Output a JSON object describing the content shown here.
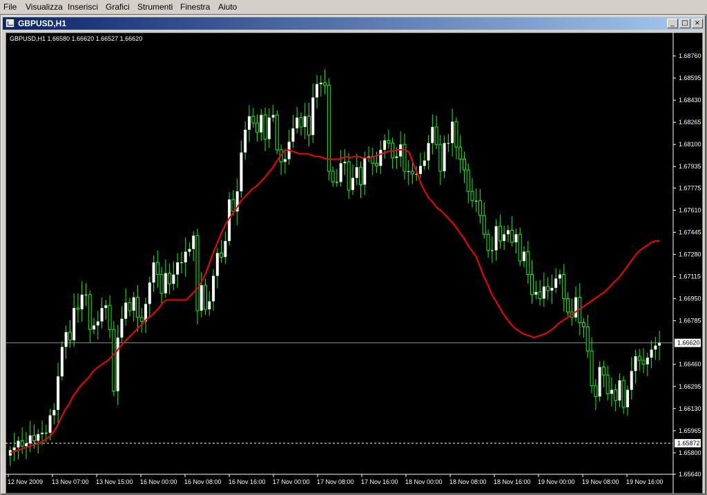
{
  "menu": [
    "File",
    "Visualizza",
    "Inserisci",
    "Grafici",
    "Strumenti",
    "Finestra",
    "Aiuto"
  ],
  "window": {
    "title": "GBPUSD,H1"
  },
  "chart_header": {
    "text": "GBPUSD,H1  1.66580 1.66620 1.66527 1.66620"
  },
  "colors": {
    "background": "#000000",
    "up_body": "#ffffff",
    "down_body": "#000000",
    "wick": "#00ff00",
    "ma": "#ff0000",
    "axis_text": "#ffffff",
    "price_line": "#8c8c8c"
  },
  "chart_data": {
    "type": "candlestick",
    "symbol": "GBPUSD",
    "timeframe": "H1",
    "y_ticks": [
      "1.68760",
      "1.68595",
      "1.68430",
      "1.68265",
      "1.68100",
      "1.67935",
      "1.67775",
      "1.67610",
      "1.67445",
      "1.67280",
      "1.67115",
      "1.66950",
      "1.66785",
      "1.66620",
      "1.66460",
      "1.66295",
      "1.66130",
      "1.65965",
      "1.65800",
      "1.65640"
    ],
    "ylim": [
      1.6564,
      1.6876
    ],
    "x_ticks": [
      "12 Nov 2009",
      "13 Nov 07:00",
      "13 Nov 15:00",
      "16 Nov 00:00",
      "16 Nov 08:00",
      "16 Nov 16:00",
      "17 Nov 00:00",
      "17 Nov 08:00",
      "17 Nov 16:00",
      "18 Nov 00:00",
      "18 Nov 08:00",
      "18 Nov 16:00",
      "19 Nov 00:00",
      "19 Nov 08:00",
      "19 Nov 16:00"
    ],
    "current_price": "1.66620",
    "level_label": "1.65872",
    "level_price": 1.65872,
    "close": [
      1.6582,
      1.6584,
      1.6589,
      1.6585,
      1.6587,
      1.6593,
      1.6589,
      1.6594,
      1.6595,
      1.6595,
      1.6608,
      1.6612,
      1.6637,
      1.6659,
      1.667,
      1.6664,
      1.6688,
      1.6687,
      1.6698,
      1.6698,
      1.6672,
      1.6675,
      1.6678,
      1.6688,
      1.669,
      1.6672,
      1.6626,
      1.6666,
      1.668,
      1.6692,
      1.6686,
      1.6696,
      1.6681,
      1.6678,
      1.6691,
      1.6707,
      1.6722,
      1.6713,
      1.6699,
      1.6714,
      1.6706,
      1.6713,
      1.6722,
      1.6722,
      1.673,
      1.6732,
      1.6742,
      1.6686,
      1.6705,
      1.6687,
      1.6693,
      1.6712,
      1.6729,
      1.6726,
      1.6738,
      1.6769,
      1.676,
      1.6775,
      1.6804,
      1.6821,
      1.6831,
      1.6826,
      1.6819,
      1.6832,
      1.6814,
      1.683,
      1.6832,
      1.6806,
      1.6797,
      1.6799,
      1.6812,
      1.6822,
      1.683,
      1.6823,
      1.6831,
      1.6817,
      1.6845,
      1.6855,
      1.6856,
      1.6854,
      1.679,
      1.6782,
      1.6782,
      1.6796,
      1.6797,
      1.6776,
      1.6785,
      1.6793,
      1.678,
      1.68,
      1.6801,
      1.6796,
      1.6794,
      1.6806,
      1.6813,
      1.6811,
      1.68,
      1.6801,
      1.681,
      1.679,
      1.679,
      1.6788,
      1.6788,
      1.6794,
      1.6798,
      1.6811,
      1.6823,
      1.681,
      1.679,
      1.6811,
      1.6811,
      1.6827,
      1.6808,
      1.6799,
      1.6791,
      1.6775,
      1.6768,
      1.6768,
      1.6757,
      1.6743,
      1.6731,
      1.6731,
      1.6749,
      1.6738,
      1.6743,
      1.6746,
      1.6737,
      1.6743,
      1.6723,
      1.673,
      1.6713,
      1.6698,
      1.67,
      1.6695,
      1.6704,
      1.6701,
      1.6703,
      1.671,
      1.6713,
      1.6695,
      1.6685,
      1.6681,
      1.6696,
      1.6677,
      1.6674,
      1.6656,
      1.663,
      1.6622,
      1.6644,
      1.6638,
      1.6624,
      1.6627,
      1.6619,
      1.6634,
      1.6614,
      1.6627,
      1.6641,
      1.6652,
      1.6649,
      1.6646,
      1.6651,
      1.6657,
      1.666,
      1.6662
    ],
    "ma": [
      1.658,
      1.6581,
      1.6582,
      1.6583,
      1.6584,
      1.6585,
      1.6586,
      1.6587,
      1.6588,
      1.659,
      1.6592,
      1.6595,
      1.66,
      1.6606,
      1.6612,
      1.6616,
      1.6622,
      1.6626,
      1.663,
      1.6633,
      1.6636,
      1.664,
      1.6643,
      1.6645,
      1.6647,
      1.6649,
      1.6652,
      1.6655,
      1.6659,
      1.6662,
      1.6665,
      1.6668,
      1.6671,
      1.6674,
      1.6677,
      1.668,
      1.6682,
      1.6685,
      1.6688,
      1.6692,
      1.6694,
      1.6694,
      1.6694,
      1.6694,
      1.6694,
      1.6694,
      1.6697,
      1.67,
      1.6703,
      1.6708,
      1.6714,
      1.6722,
      1.673,
      1.6737,
      1.6744,
      1.675,
      1.6755,
      1.6759,
      1.6763,
      1.6768,
      1.6771,
      1.6774,
      1.6777,
      1.6779,
      1.6782,
      1.6785,
      1.6789,
      1.6792,
      1.6797,
      1.6801,
      1.6805,
      1.6806,
      1.6805,
      1.6804,
      1.6803,
      1.6803,
      1.6803,
      1.6802,
      1.6801,
      1.6801,
      1.68,
      1.6799,
      1.6799,
      1.6799,
      1.6799,
      1.68,
      1.6801,
      1.68,
      1.6801,
      1.6801,
      1.68,
      1.68,
      1.68,
      1.6801,
      1.6802,
      1.6803,
      1.6804,
      1.6805,
      1.6805,
      1.6806,
      1.6806,
      1.6806,
      1.6804,
      1.6796,
      1.6789,
      1.6781,
      1.6775,
      1.677,
      1.6767,
      1.6763,
      1.6761,
      1.6758,
      1.6755,
      1.6752,
      1.6748,
      1.6744,
      1.674,
      1.6735,
      1.6731,
      1.6727,
      1.672,
      1.6712,
      1.6706,
      1.6699,
      1.6694,
      1.6689,
      1.6684,
      1.668,
      1.6676,
      1.6673,
      1.6671,
      1.6669,
      1.6668,
      1.6667,
      1.6666,
      1.6667,
      1.6668,
      1.6669,
      1.6671,
      1.6673,
      1.6676,
      1.6678,
      1.668,
      1.6682,
      1.6684,
      1.6686,
      1.6688,
      1.669,
      1.6692,
      1.6694,
      1.6696,
      1.6698,
      1.67,
      1.6703,
      1.6706,
      1.6709,
      1.6712,
      1.6716,
      1.672,
      1.6724,
      1.6728,
      1.6731,
      1.6733,
      1.6735,
      1.6737,
      1.6738,
      1.6738
    ]
  }
}
